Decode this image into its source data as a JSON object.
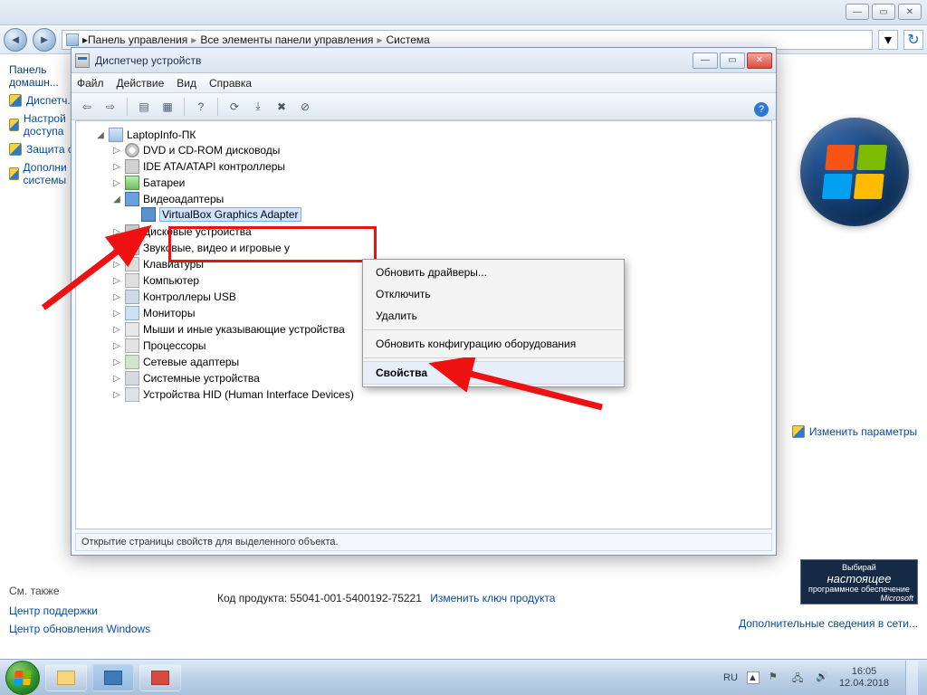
{
  "host": {
    "breadcrumb": [
      "Панель управления",
      "Все элементы панели управления",
      "Система"
    ]
  },
  "cp_sidebar": {
    "header_l1": "Панель",
    "header_l2": "домашн...",
    "links": [
      "Диспетч...",
      "Настрой доступа",
      "Защита с",
      "Дополни системы"
    ],
    "see_also_title": "См. также",
    "see_also": [
      "Центр поддержки",
      "Центр обновления Windows"
    ]
  },
  "right_pane": {
    "change_params": "Изменить параметры",
    "ms_badge_top": "Выбирай",
    "ms_badge_mid": "настоящее",
    "ms_badge_sub": "программное обеспечение",
    "ms_badge_brand": "Microsoft",
    "more_online": "Дополнительные сведения в сети..."
  },
  "product": {
    "label": "Код продукта:",
    "key": "55041-001-5400192-75221",
    "change_link": "Изменить ключ продукта"
  },
  "dm": {
    "title": "Диспетчер устройств",
    "menu": [
      "Файл",
      "Действие",
      "Вид",
      "Справка"
    ],
    "status": "Открытие страницы свойств для выделенного объекта.",
    "root": "LaptopInfo-ПК",
    "nodes": [
      {
        "label": "DVD и CD-ROM дисководы",
        "icon": "ic-disc"
      },
      {
        "label": "IDE ATA/ATAPI контроллеры",
        "icon": "ic-ide"
      },
      {
        "label": "Батареи",
        "icon": "ic-bat"
      },
      {
        "label": "Видеоадаптеры",
        "icon": "ic-vid",
        "expanded": true,
        "children": [
          {
            "label": "VirtualBox Graphics Adapter",
            "icon": "ic-adapter",
            "selected": true
          }
        ]
      },
      {
        "label": "Дисковые устройства",
        "icon": "ic-hdd"
      },
      {
        "label": "Звуковые, видео и игровые у",
        "icon": "ic-snd"
      },
      {
        "label": "Клавиатуры",
        "icon": "ic-kbd"
      },
      {
        "label": "Компьютер",
        "icon": "ic-cpu"
      },
      {
        "label": "Контроллеры USB",
        "icon": "ic-usb"
      },
      {
        "label": "Мониторы",
        "icon": "ic-mon"
      },
      {
        "label": "Мыши и иные указывающие устройства",
        "icon": "ic-mouse"
      },
      {
        "label": "Процессоры",
        "icon": "ic-proc"
      },
      {
        "label": "Сетевые адаптеры",
        "icon": "ic-net"
      },
      {
        "label": "Системные устройства",
        "icon": "ic-sys"
      },
      {
        "label": "Устройства HID (Human Interface Devices)",
        "icon": "ic-hid"
      }
    ]
  },
  "context_menu": {
    "items": [
      {
        "label": "Обновить драйверы..."
      },
      {
        "label": "Отключить"
      },
      {
        "label": "Удалить"
      },
      {
        "sep": true
      },
      {
        "label": "Обновить конфигурацию оборудования"
      },
      {
        "sep": true
      },
      {
        "label": "Свойства",
        "highlight": true
      }
    ]
  },
  "taskbar": {
    "lang": "RU",
    "time": "16:05",
    "date": "12.04.2018"
  }
}
